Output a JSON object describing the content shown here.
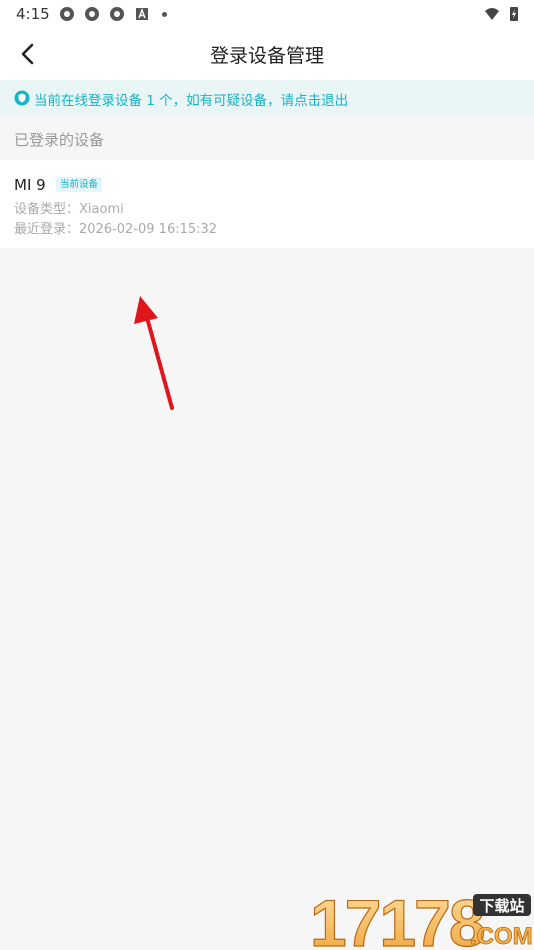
{
  "status_bar": {
    "time": "4:15"
  },
  "header": {
    "title": "登录设备管理"
  },
  "notice": {
    "text": "当前在线登录设备 1 个，如有可疑设备，请点击退出"
  },
  "section": {
    "label": "已登录的设备"
  },
  "devices": [
    {
      "name": "MI 9",
      "badge": "当前设备",
      "type_line": "设备类型：Xiaomi",
      "time_line": "最近登录：2026-02-09 16:15:32"
    }
  ],
  "watermark": {
    "digits": "17178",
    "tag": "下载站",
    "domain": ".COM"
  },
  "colors": {
    "accent": "#17b3c8",
    "notice_bg": "#eaf5f6",
    "arrow": "#e0141b"
  }
}
